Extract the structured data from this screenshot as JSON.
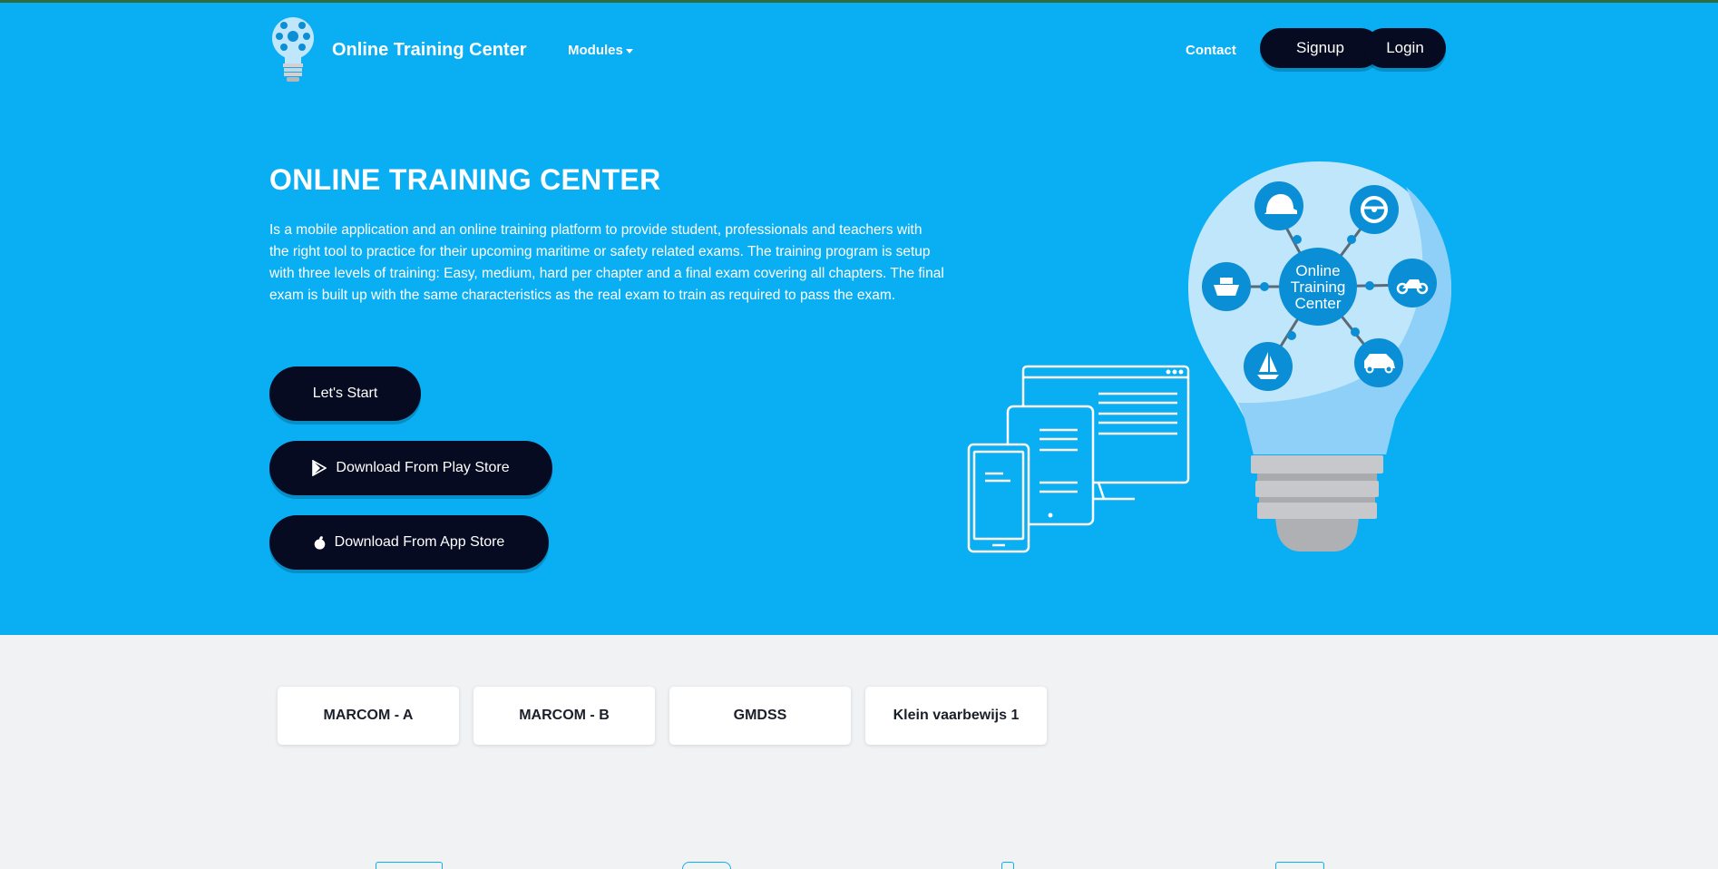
{
  "brand": {
    "name": "Online Training Center"
  },
  "nav": {
    "modules_label": "Modules",
    "contact_label": "Contact",
    "signup_label": "Signup",
    "login_label": "Login"
  },
  "hero": {
    "title": "ONLINE TRAINING CENTER",
    "description": "Is a mobile application and an online training platform to provide student, professionals and teachers with the right tool to practice for their upcoming maritime or safety related exams. The training program is setup with three levels of training: Easy, medium, hard per chapter and a final exam covering all chapters. The final exam is built up with the same characteristics as the real exam to train as required to pass the exam.",
    "start_label": "Let's Start",
    "play_label": "Download From Play Store",
    "app_label": "Download From App Store",
    "bulb_label": [
      "Online",
      "Training",
      "Center"
    ]
  },
  "modules": [
    {
      "label": "MARCOM - A"
    },
    {
      "label": "MARCOM - B"
    },
    {
      "label": "GMDSS"
    },
    {
      "label": "Klein vaarbewijs 1"
    }
  ],
  "colors": {
    "hero_bg": "#09aef3",
    "button_dark": "#060b21",
    "section_bg": "#f1f2f4"
  },
  "icons": [
    "lightbulb-logo-icon",
    "caret-down-icon",
    "play-store-icon",
    "apple-icon",
    "helmet-icon",
    "steering-wheel-icon",
    "ship-icon",
    "motorbike-icon",
    "sailboat-icon",
    "car-icon"
  ]
}
